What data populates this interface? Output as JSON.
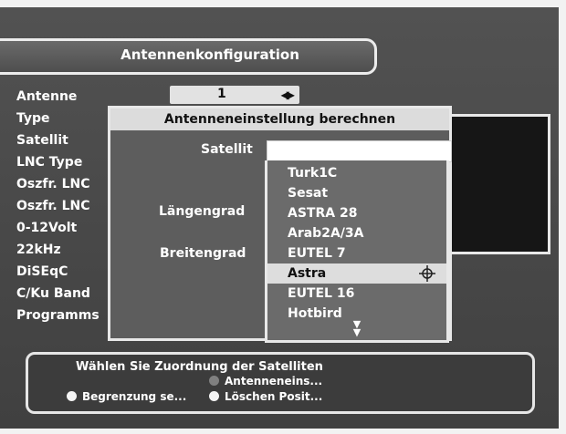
{
  "title": "Antennenkonfiguration",
  "settings": {
    "labels": [
      "Antenne",
      "Type",
      "Satellit",
      "LNC Type",
      "Oszfr. LNC",
      "Oszfr. LNC",
      "0-12Volt",
      "22kHz",
      "DiSEqC",
      "C/Ku Band",
      "Programms"
    ],
    "antenne_value": "1"
  },
  "dialog": {
    "title": "Antenneneinstellung berechnen",
    "satellit_label": "Satellit",
    "laengengrad_label": "Längengrad",
    "breitengrad_label": "Breitengrad",
    "satellit_value": "",
    "options": [
      "Turk1C",
      "Sesat",
      "ASTRA 28",
      "Arab2A/3A",
      "EUTEL 7",
      "Astra",
      "EUTEL 16",
      "Hotbird"
    ],
    "selected_index": 5
  },
  "help": {
    "text": "Wählen Sie Zuordnung der Satelliten",
    "buttons": {
      "antenneneins": "Antenneneins...",
      "begrenzung": "Begrenzung se...",
      "loeschen": "Löschen Posit..."
    }
  },
  "colors": {
    "screen_bg": "#4a4a4a",
    "dialog_bg": "#5d5d5d",
    "highlight": "#dddddd",
    "text": "#ffffff"
  },
  "icons": {
    "antenne_arrows": "left-right-arrows-icon",
    "selection": "crosshair-icon",
    "scroll": "scroll-down-icon"
  }
}
